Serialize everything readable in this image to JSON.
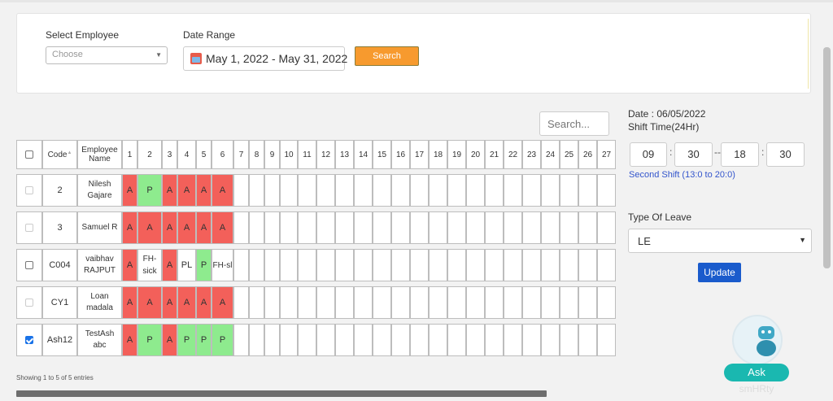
{
  "filters": {
    "employee_label": "Select Employee",
    "employee_placeholder": "Choose",
    "date_range_label": "Date Range",
    "date_range_value": "May 1, 2022 - May 31, 2022",
    "search_button": "Search"
  },
  "table": {
    "search_placeholder": "Search...",
    "headers": {
      "code": "Code",
      "employee_name": "Employee Name",
      "days": [
        "1",
        "2",
        "3",
        "4",
        "5",
        "6",
        "7",
        "8",
        "9",
        "10",
        "11",
        "12",
        "13",
        "14",
        "15",
        "16",
        "17",
        "18",
        "19",
        "20",
        "21",
        "22",
        "23",
        "24",
        "25",
        "26",
        "27"
      ]
    },
    "rows": [
      {
        "checked": false,
        "disabled": true,
        "code": "2",
        "name": "Nilesh Gajare",
        "days": [
          "A",
          "P",
          "A",
          "A",
          "A",
          "A"
        ]
      },
      {
        "checked": false,
        "disabled": true,
        "code": "3",
        "name": "Samuel R",
        "days": [
          "A",
          "A",
          "A",
          "A",
          "A",
          "A"
        ]
      },
      {
        "checked": false,
        "disabled": false,
        "code": "C004",
        "name": "vaibhav RAJPUT",
        "days": [
          "A",
          "FH-sick",
          "A",
          "PL",
          "P",
          "FH-sl"
        ]
      },
      {
        "checked": false,
        "disabled": true,
        "code": "CY1",
        "name": "Loan madala",
        "days": [
          "A",
          "A",
          "A",
          "A",
          "A",
          "A"
        ]
      },
      {
        "checked": true,
        "disabled": false,
        "code": "Ash12",
        "name": "TestAsh abc",
        "days": [
          "A",
          "P",
          "A",
          "P",
          "P",
          "P"
        ]
      }
    ],
    "footer": "Showing 1 to 5 of 5 entries"
  },
  "side_panel": {
    "date": "Date : 06/05/2022",
    "shift_label": "Shift Time(24Hr)",
    "start_hour": "09",
    "start_min": "30",
    "end_hour": "18",
    "end_min": "30",
    "colon": ":",
    "dash": "--",
    "shift_name": "Second Shift (13:0 to 20:0)",
    "leave_label": "Type Of Leave",
    "leave_value": "LE",
    "update_button": "Update"
  },
  "assistant": {
    "ask_label": "Ask",
    "name": "smHRty"
  },
  "colors": {
    "absent": "#f3605a",
    "present": "#8eeb8e",
    "search_button": "#f79a2e",
    "update_button": "#1a5bcc",
    "ask_button": "#1ab8b0"
  }
}
